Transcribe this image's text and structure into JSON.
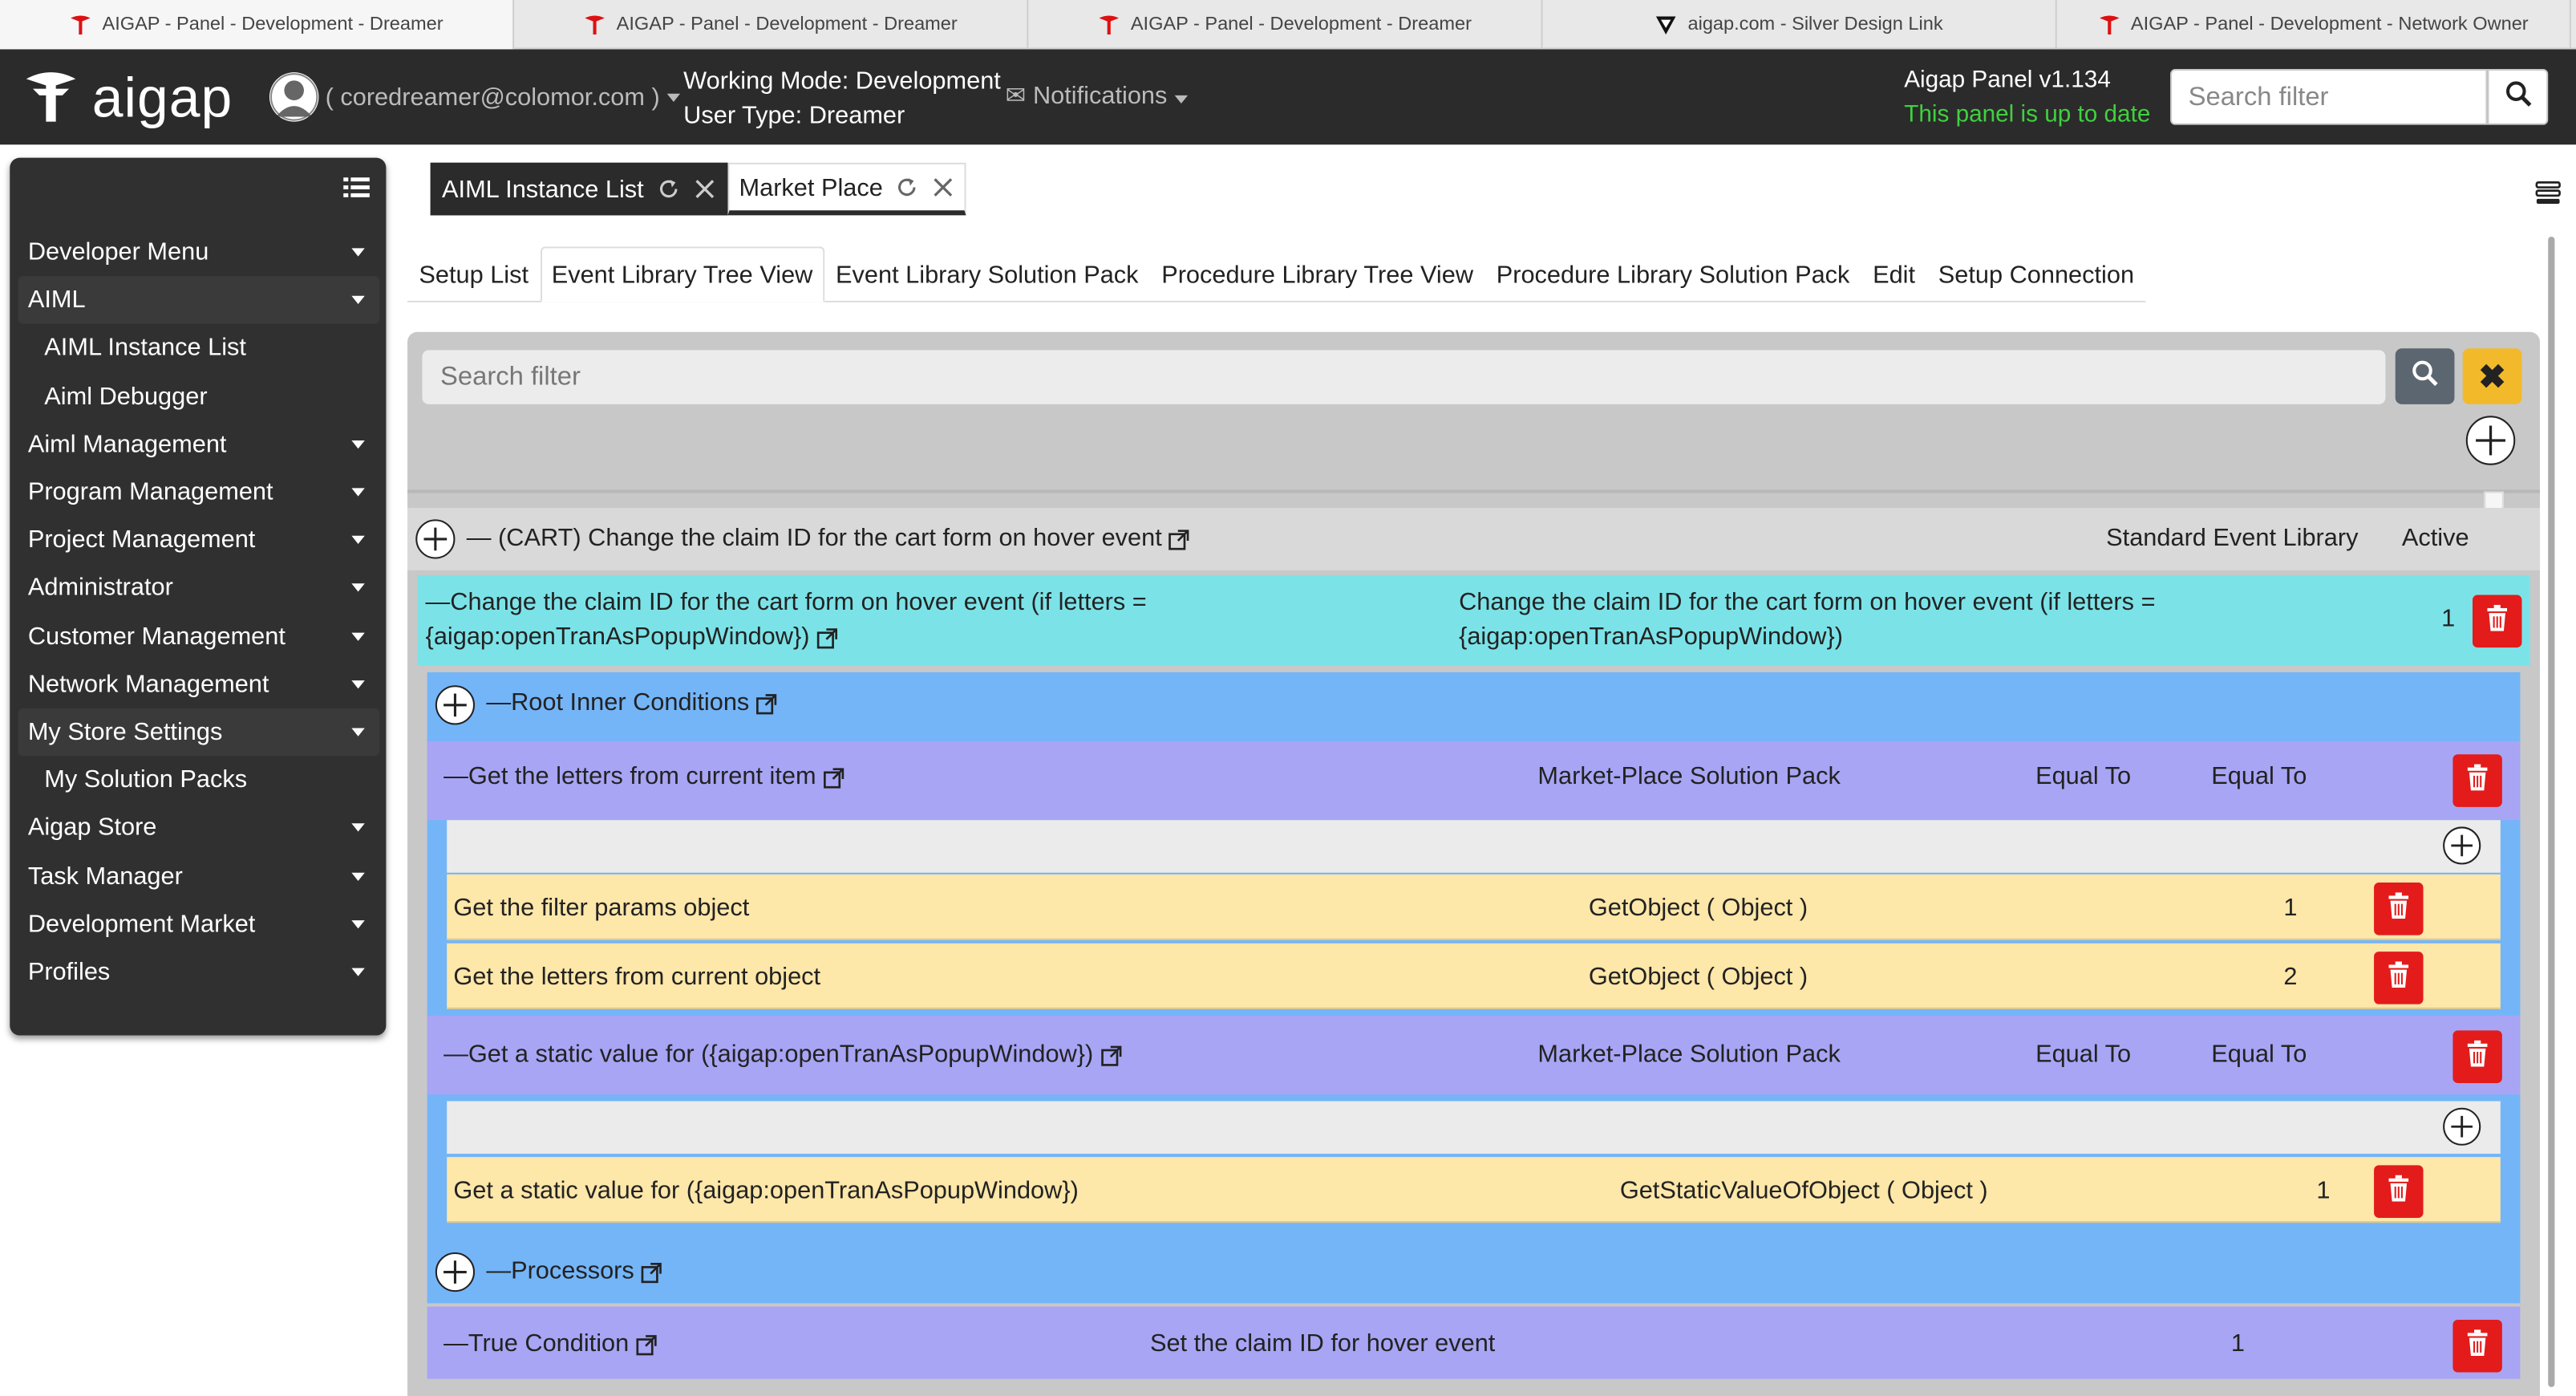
{
  "browser_tabs": [
    {
      "label": "AIGAP - Panel - Development - Dreamer"
    },
    {
      "label": "AIGAP - Panel - Development - Dreamer"
    },
    {
      "label": "AIGAP - Panel - Development - Dreamer"
    },
    {
      "label": "aigap.com - Silver Design Link"
    },
    {
      "label": "AIGAP - Panel - Development - Network Owner"
    }
  ],
  "header": {
    "logo_text": "aigap",
    "user_email": "( coredreamer@colomor.com )",
    "working_mode": "Working Mode: Development",
    "user_type": "User Type: Dreamer",
    "notifications_label": "Notifications",
    "version": "Aigap Panel v1.134",
    "status": "This panel is up to date",
    "search_placeholder": "Search filter",
    "status_color": "#3fd13f"
  },
  "sidebar": {
    "items": [
      {
        "label": "Developer Menu"
      },
      {
        "label": "AIML"
      },
      {
        "label": "AIML Instance List"
      },
      {
        "label": "Aiml Debugger"
      },
      {
        "label": "Aiml Management"
      },
      {
        "label": "Program Management"
      },
      {
        "label": "Project Management"
      },
      {
        "label": "Administrator"
      },
      {
        "label": "Customer Management"
      },
      {
        "label": "Network Management"
      },
      {
        "label": "My Store Settings"
      },
      {
        "label": "My Solution Packs"
      },
      {
        "label": "Aigap Store"
      },
      {
        "label": "Task Manager"
      },
      {
        "label": "Development Market"
      },
      {
        "label": "Profiles"
      }
    ]
  },
  "app_tabs": [
    {
      "label": "AIML Instance List"
    },
    {
      "label": "Market Place"
    }
  ],
  "sub_tabs": [
    {
      "label": "Setup List"
    },
    {
      "label": "Event Library Tree View"
    },
    {
      "label": "Event Library Solution Pack"
    },
    {
      "label": "Procedure Library Tree View"
    },
    {
      "label": "Procedure Library Solution Pack"
    },
    {
      "label": "Edit"
    },
    {
      "label": "Setup Connection"
    }
  ],
  "panel": {
    "search_placeholder": "Search filter",
    "clear_glyph": "✖",
    "main_row": {
      "title": "— (CART) Change the claim ID for the cart form on hover event",
      "library": "Standard Event Library",
      "status": "Active"
    },
    "event_row": {
      "title_line1": "—Change the claim ID for the cart form on hover event (if letters =",
      "title_line2": "{aigap:openTranAsPopupWindow})",
      "desc_line1": "Change the claim ID for the cart form on hover event (if letters =",
      "desc_line2": "{aigap:openTranAsPopupWindow})",
      "order": "1"
    },
    "root_conditions": {
      "title": "—Root Inner Conditions"
    },
    "conditions": [
      {
        "title": "—Get the letters from current item",
        "pack": "Market-Place Solution Pack",
        "op1": "Equal To",
        "op2": "Equal To",
        "items": [
          {
            "name": "Get the filter params object",
            "function": "GetObject ( Object )",
            "order": "1"
          },
          {
            "name": "Get the letters from current object",
            "function": "GetObject ( Object )",
            "order": "2"
          }
        ]
      },
      {
        "title": "—Get a static value for ({aigap:openTranAsPopupWindow})",
        "pack": "Market-Place Solution Pack",
        "op1": "Equal To",
        "op2": "Equal To",
        "items": [
          {
            "name": "Get a static value for ({aigap:openTranAsPopupWindow})",
            "function": "GetStaticValueOfObject ( Object )",
            "order": "1"
          }
        ]
      }
    ],
    "processors": {
      "title": "—Processors"
    },
    "true_condition": {
      "title": "—True Condition",
      "desc": "Set the claim ID for hover event",
      "order": "1"
    }
  },
  "colors": {
    "header_bg": "#2b2b2b",
    "event_row": "#7be3e8",
    "root_row": "#74b5f8",
    "condition_row": "#a8a5f5",
    "item_row": "#fde7a9",
    "trash": "#e31b1b",
    "clear_button": "#f2b92b"
  },
  "icons": [
    "aigap-logo-icon",
    "user-avatar-icon",
    "envelope-icon",
    "search-icon",
    "list-icon",
    "refresh-icon",
    "close-icon",
    "plus-circle-icon",
    "external-link-icon",
    "trash-icon",
    "menu-icon"
  ]
}
